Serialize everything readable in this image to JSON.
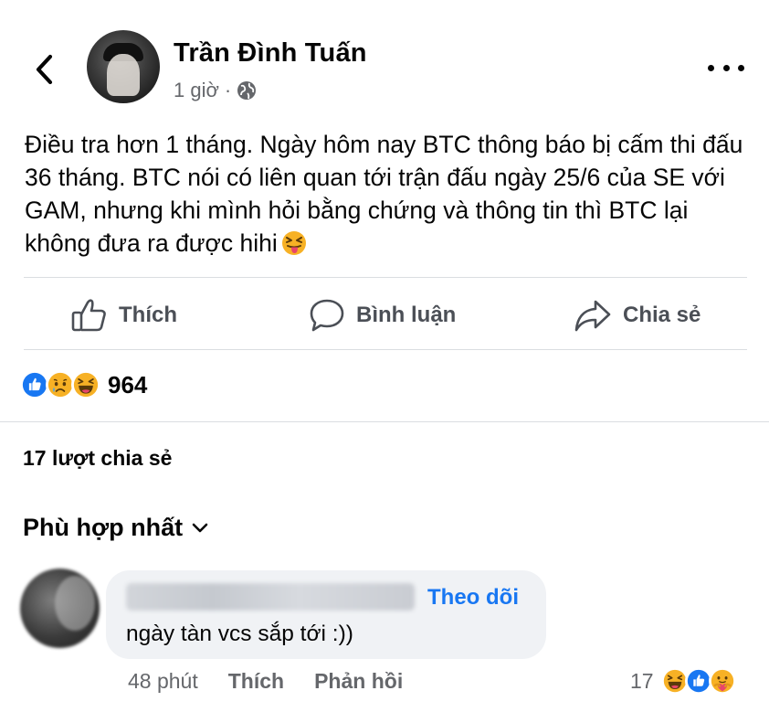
{
  "post": {
    "author": "Trần Đình Tuấn",
    "time": "1 giờ",
    "separator": "·",
    "privacy_icon": "globe-icon",
    "text": "Điều tra hơn 1 tháng. Ngày hôm nay BTC thông báo bị cấm thi đấu 36 tháng. BTC nói có liên quan tới trận đấu ngày 25/6 của SE với GAM, nhưng khi mình hỏi bằng chứng và thông tin thì BTC lại không đưa ra được hihi",
    "text_emoji": "squinting-tongue-emoji"
  },
  "actions": {
    "like": "Thích",
    "comment": "Bình luận",
    "share": "Chia sẻ"
  },
  "reactions": {
    "icons": [
      "like-icon",
      "sad-icon",
      "haha-icon"
    ],
    "count": "964"
  },
  "shares": "17 lượt chia sẻ",
  "sort": {
    "label": "Phù hợp nhất"
  },
  "comment": {
    "follow": "Theo dõi",
    "text": "ngày tàn vcs sắp tới :))",
    "time": "48 phút",
    "like": "Thích",
    "reply": "Phản hồi",
    "reaction_count": "17",
    "reaction_icons": [
      "haha-icon",
      "like-icon",
      "care-icon"
    ]
  },
  "colors": {
    "accent": "#1877f2",
    "secondary_text": "#65676b",
    "divider": "#dadde1",
    "bubble": "#f0f2f5",
    "reaction_yellow": "#f7b125"
  }
}
